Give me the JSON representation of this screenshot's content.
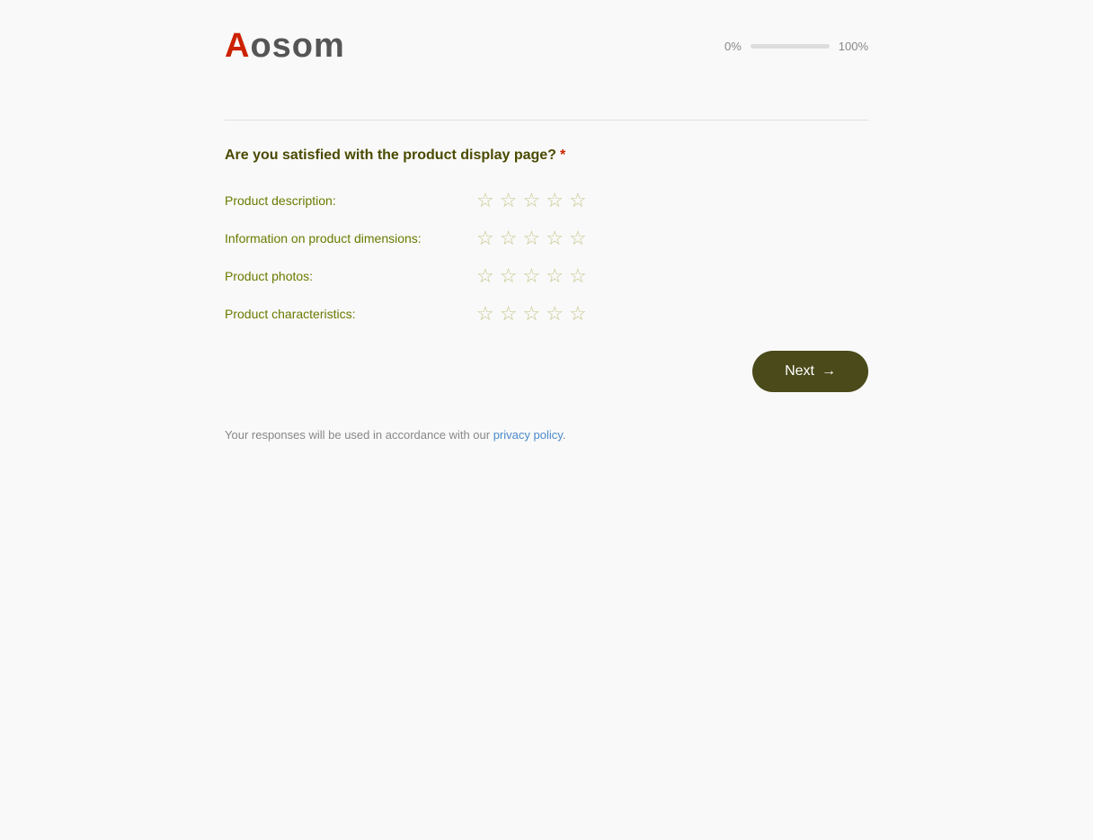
{
  "brand": {
    "logo_prefix": "A",
    "logo_rest": "osom"
  },
  "progress": {
    "left_label": "0%",
    "right_label": "100%",
    "fill_percent": 0
  },
  "question": {
    "text": "Are you satisfied with the product display page?",
    "required": true,
    "rows": [
      {
        "id": "product-description",
        "label": "Product description:"
      },
      {
        "id": "product-dimensions",
        "label": "Information on product dimensions:"
      },
      {
        "id": "product-photos",
        "label": "Product photos:"
      },
      {
        "id": "product-characteristics",
        "label": "Product characteristics:"
      }
    ]
  },
  "next_button": {
    "label": "Next",
    "arrow": "→"
  },
  "footer": {
    "text_before_link": "Your responses will be used in accordance with our ",
    "link_text": "privacy policy",
    "text_after_link": "."
  }
}
